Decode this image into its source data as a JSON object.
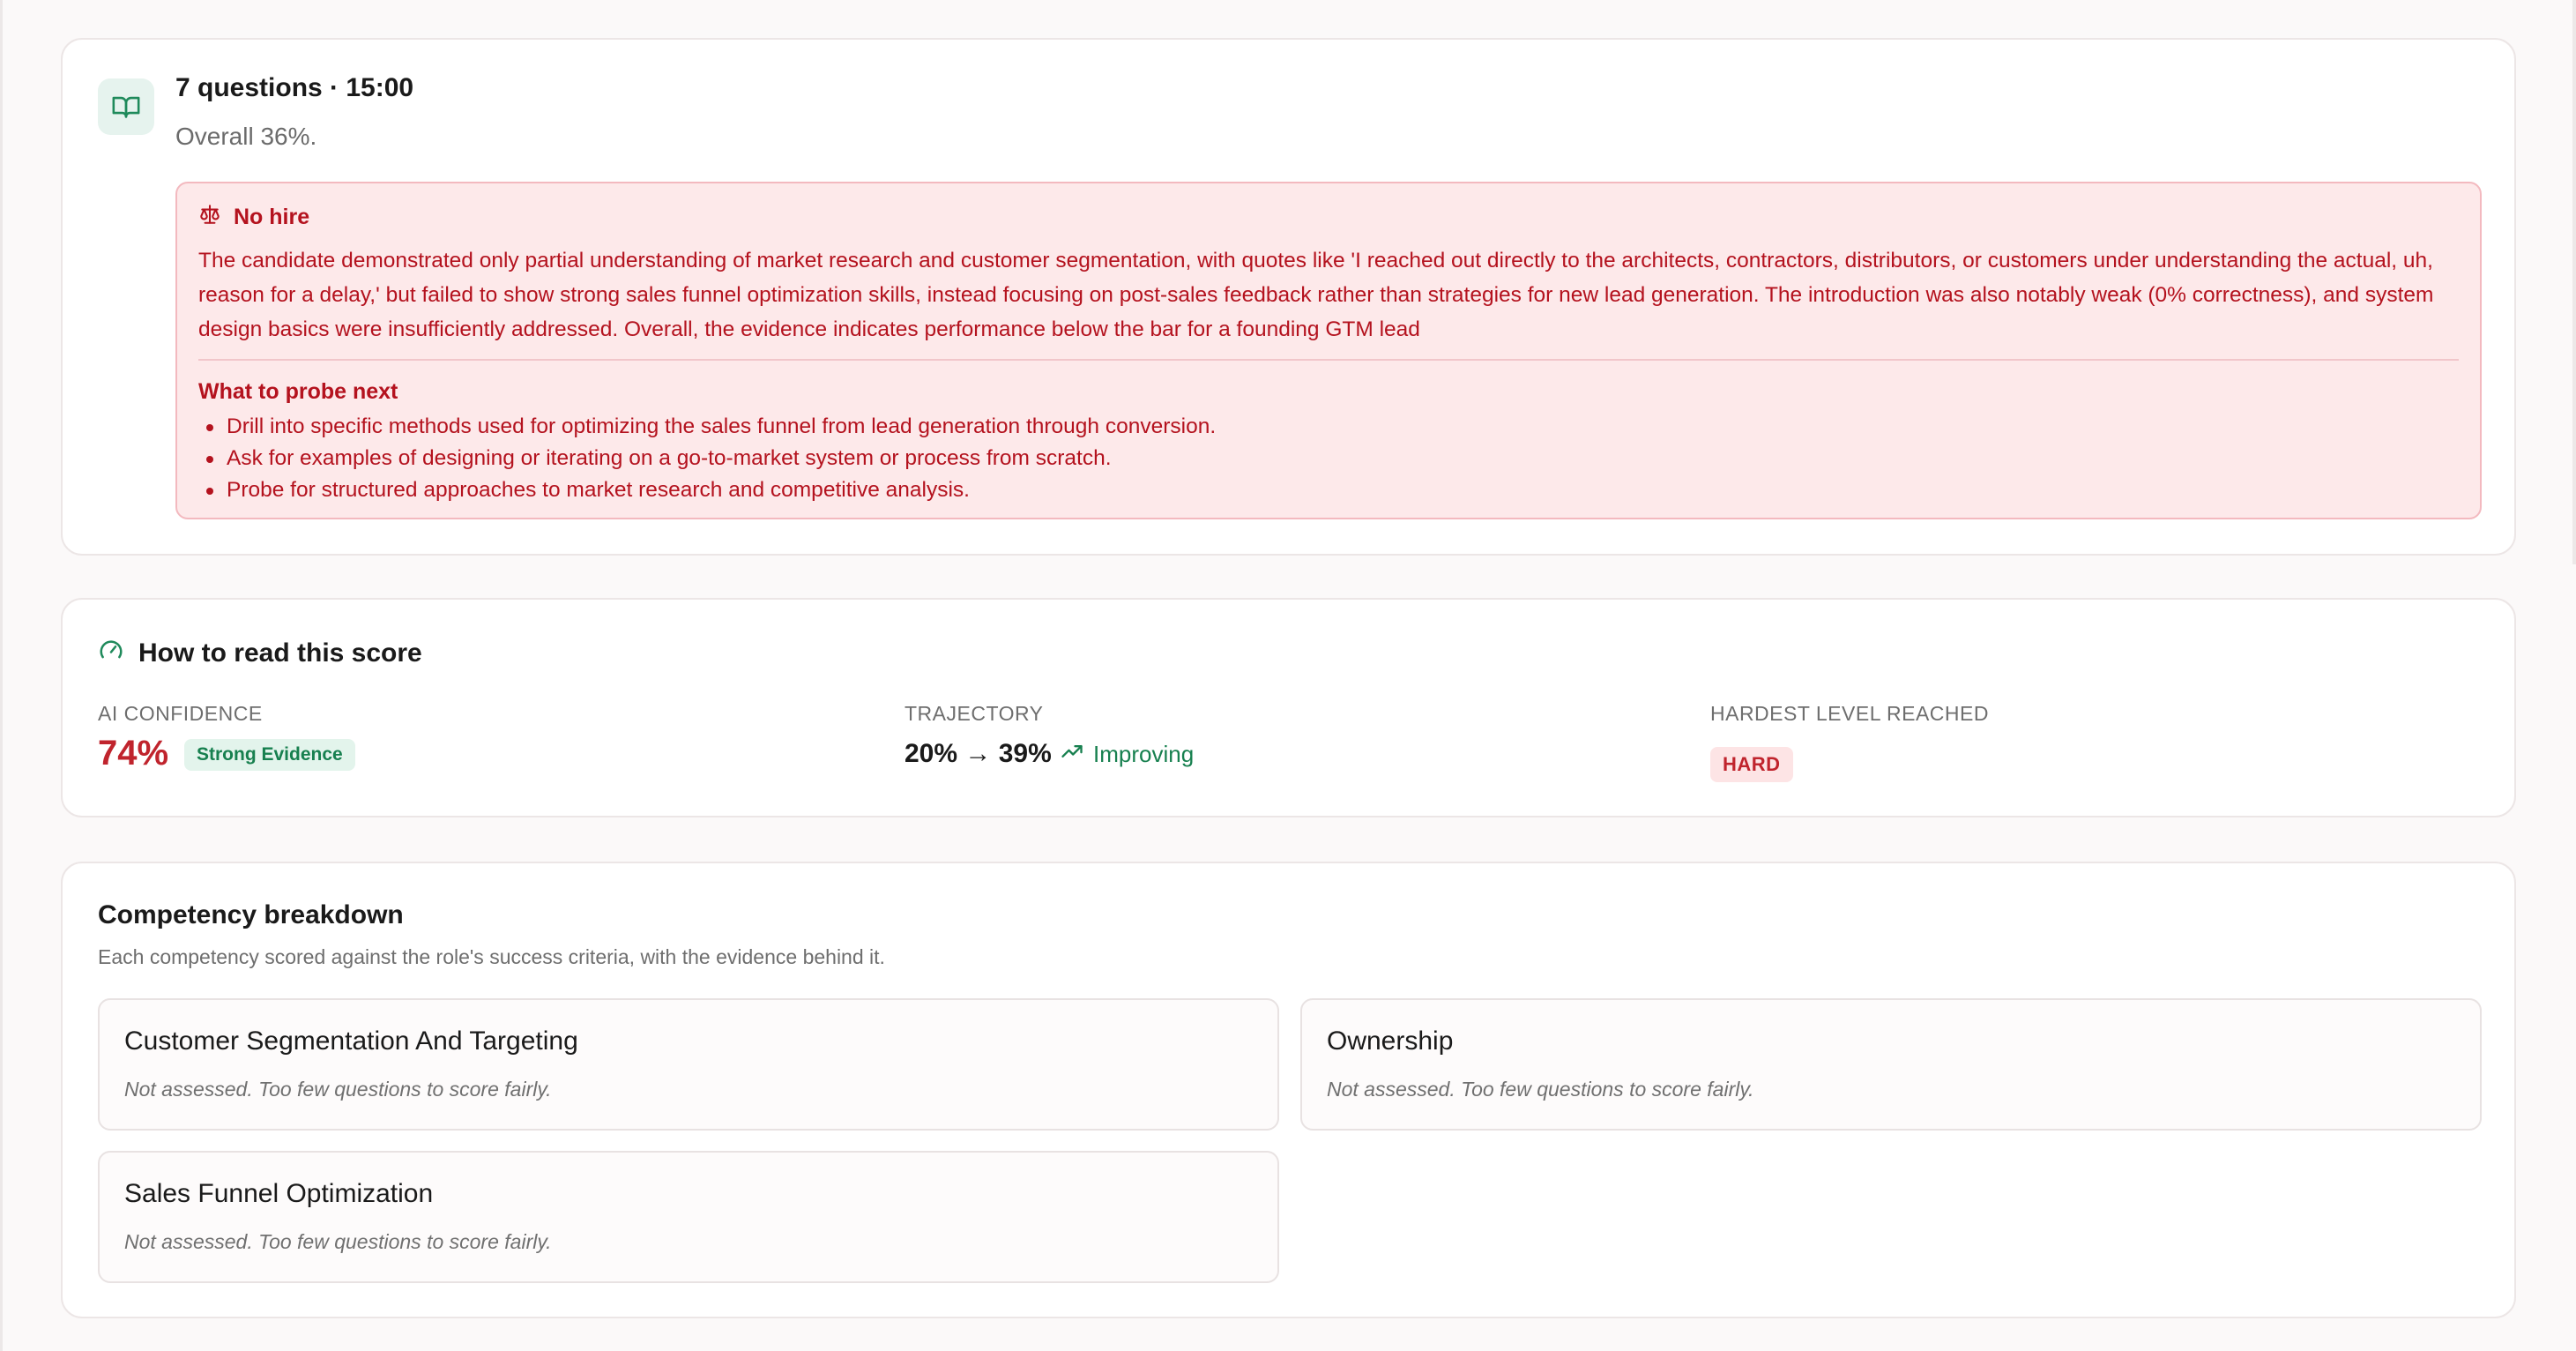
{
  "summary": {
    "title": "7 questions · 15:00",
    "overall": "Overall 36%.",
    "verdict": {
      "label": "No hire",
      "body": "The candidate demonstrated only partial understanding of market research and customer segmentation, with quotes like 'I reached out directly to the architects, contractors, distributors, or customers under understanding the actual, uh, reason for a delay,' but failed to show strong sales funnel optimization skills, instead focusing on post-sales feedback rather than strategies for new lead generation. The introduction was also notably weak (0% correctness), and system design basics were insufficiently addressed. Overall, the evidence indicates performance below the bar for a founding GTM lead",
      "probe_title": "What to probe next",
      "probe_items": [
        "Drill into specific methods used for optimizing the sales funnel from lead generation through conversion.",
        "Ask for examples of designing or iterating on a go-to-market system or process from scratch.",
        "Probe for structured approaches to market research and competitive analysis."
      ]
    }
  },
  "score_guide": {
    "title": "How to read this score",
    "confidence": {
      "label": "AI CONFIDENCE",
      "value": "74%",
      "badge": "Strong Evidence"
    },
    "trajectory": {
      "label": "TRAJECTORY",
      "value": "20% → 39%",
      "status": "Improving"
    },
    "hardest": {
      "label": "HARDEST LEVEL REACHED",
      "value": "HARD"
    }
  },
  "competency": {
    "title": "Competency breakdown",
    "subtitle": "Each competency scored against the role's success criteria, with the evidence behind it.",
    "items": [
      {
        "name": "Customer Segmentation And Targeting",
        "note": "Not assessed. Too few questions to score fairly."
      },
      {
        "name": "Ownership",
        "note": "Not assessed. Too few questions to score fairly."
      },
      {
        "name": "Sales Funnel Optimization",
        "note": "Not assessed. Too few questions to score fairly."
      }
    ]
  },
  "colors": {
    "accent_green": "#17804f",
    "danger_red": "#b4121e",
    "verdict_bg": "#fde9ea"
  },
  "icons": [
    "book-open-icon",
    "scale-icon",
    "gauge-icon",
    "trending-up-icon"
  ]
}
